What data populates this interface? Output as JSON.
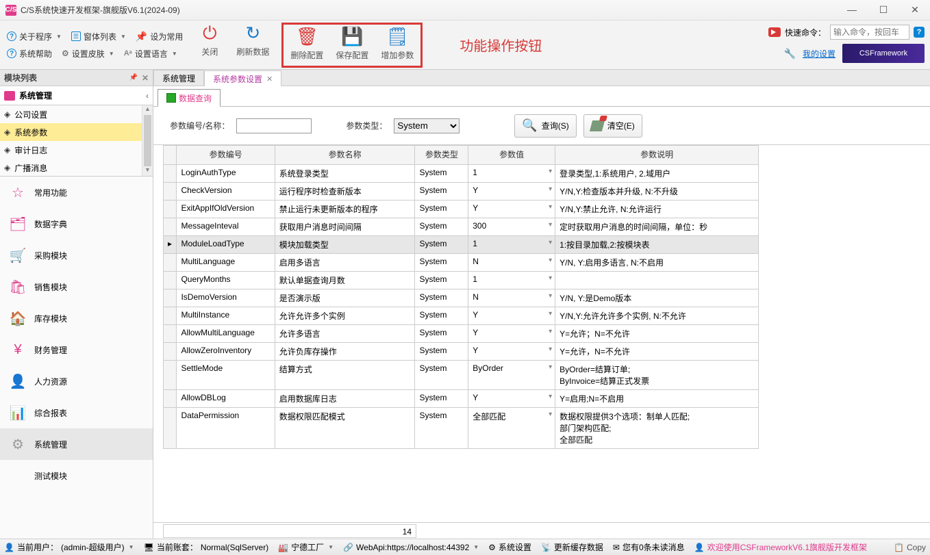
{
  "window": {
    "title": "C/S系统快速开发框架-旗舰版V6.1(2024-09)",
    "app_icon": "C/S"
  },
  "win_btns": {
    "min": "—",
    "max": "☐",
    "close": "✕"
  },
  "menubar": {
    "row1": {
      "about": "关于程序",
      "formlist": "窗体列表",
      "setdefault": "设为常用"
    },
    "row2": {
      "syshelp": "系统帮助",
      "skin": "设置皮肤",
      "lang": "设置语言"
    },
    "big": {
      "close": "关闭",
      "refresh": "刷新数据",
      "delcfg": "删除配置",
      "savecfg": "保存配置",
      "addparam": "增加参数"
    },
    "func_label": "功能操作按钮"
  },
  "quick": {
    "label": "快速命令：",
    "placeholder": "输入命令，按回车",
    "mysettings": "我的设置",
    "csfw": "CSFramework"
  },
  "sidebar": {
    "panel_title": "模块列表",
    "tree_title": "系统管理",
    "tree_items": [
      "公司设置",
      "系统参数",
      "审计日志",
      "广播消息"
    ],
    "modules": [
      "常用功能",
      "数据字典",
      "采购模块",
      "销售模块",
      "库存模块",
      "财务管理",
      "人力资源",
      "综合报表",
      "系统管理",
      "测试模块"
    ],
    "selected_module_idx": 8
  },
  "tabs": {
    "t1": "系统管理",
    "t2": "系统参数设置"
  },
  "subtab": "数据查询",
  "search": {
    "label1": "参数编号/名称：",
    "label2": "参数类型：",
    "type_value": "System",
    "search_btn": "查询(S)",
    "clear_btn": "清空(E)"
  },
  "grid": {
    "headers": [
      "参数编号",
      "参数名称",
      "参数类型",
      "参数值",
      "参数说明"
    ],
    "rows": [
      {
        "id": "LoginAuthType",
        "name": "系统登录类型",
        "type": "System",
        "val": "1",
        "desc": "登录类型,1:系统用户, 2.域用户"
      },
      {
        "id": "CheckVersion",
        "name": "运行程序时检查新版本",
        "type": "System",
        "val": "Y",
        "desc": "Y/N,Y:检查版本并升级, N:不升级"
      },
      {
        "id": "ExitAppIfOldVersion",
        "name": "禁止运行未更新版本的程序",
        "type": "System",
        "val": "Y",
        "desc": "Y/N,Y:禁止允许, N:允许运行"
      },
      {
        "id": "MessageInteval",
        "name": "获取用户消息时间间隔",
        "type": "System",
        "val": "300",
        "desc": "定时获取用户消息的时间间隔，单位：秒"
      },
      {
        "id": "ModuleLoadType",
        "name": "模块加载类型",
        "type": "System",
        "val": "1",
        "desc": "1:按目录加载,2:按模块表",
        "hl": true
      },
      {
        "id": "MultiLanguage",
        "name": "启用多语言",
        "type": "System",
        "val": "N",
        "desc": "Y/N, Y:启用多语言, N:不启用"
      },
      {
        "id": "QueryMonths",
        "name": "默认单据查询月数",
        "type": "System",
        "val": "1",
        "desc": ""
      },
      {
        "id": "IsDemoVersion",
        "name": "是否演示版",
        "type": "System",
        "val": "N",
        "desc": "Y/N, Y:是Demo版本"
      },
      {
        "id": "MultiInstance",
        "name": "允许允许多个实例",
        "type": "System",
        "val": "Y",
        "desc": "Y/N,Y:允许允许多个实例, N:不允许"
      },
      {
        "id": "AllowMultiLanguage",
        "name": "允许多语言",
        "type": "System",
        "val": "Y",
        "desc": "Y=允许；N=不允许"
      },
      {
        "id": "AllowZeroInventory",
        "name": "允许负库存操作",
        "type": "System",
        "val": "Y",
        "desc": "Y=允许，N=不允许"
      },
      {
        "id": "SettleMode",
        "name": "结算方式",
        "type": "System",
        "val": "ByOrder",
        "desc": "ByOrder=结算订单;\nByInvoice=结算正式发票"
      },
      {
        "id": "AllowDBLog",
        "name": "启用数据库日志",
        "type": "System",
        "val": "Y",
        "desc": "Y=启用;N=不启用"
      },
      {
        "id": "DataPermission",
        "name": "数据权限匹配模式",
        "type": "System",
        "val": "全部匹配",
        "desc": "数据权限提供3个选项：制单人匹配;\n部门架构匹配;\n全部匹配"
      }
    ],
    "count": "14"
  },
  "statusbar": {
    "user_label": "当前用户：",
    "user": "(admin-超级用户)",
    "acct_label": "当前账套：",
    "acct": "Normal(SqlServer)",
    "factory": "宁德工厂",
    "webapi": "WebApi:https://localhost:44392",
    "syssetting": "系统设置",
    "cache": "更新缓存数据",
    "msg": "您有0条未读消息",
    "welcome": "欢迎使用CSFrameworkV6.1旗舰版开发框架",
    "copy": "Copy"
  }
}
